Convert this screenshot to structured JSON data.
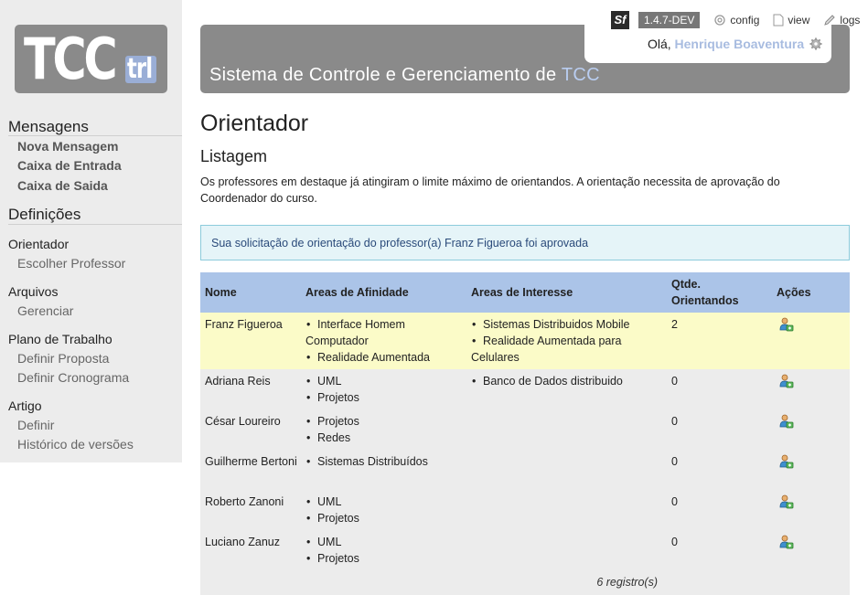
{
  "logo": {
    "main": "TCC",
    "suffix": "trl"
  },
  "sidebar": {
    "sections": [
      {
        "heading": "Mensagens",
        "links": [
          "Nova Mensagem",
          "Caixa de Entrada",
          "Caixa de Saida"
        ]
      },
      {
        "heading": "Definições"
      }
    ],
    "groups": [
      {
        "label": "Orientador",
        "links": [
          "Escolher Professor"
        ]
      },
      {
        "label": "Arquivos",
        "links": [
          "Gerenciar"
        ]
      },
      {
        "label": "Plano de Trabalho",
        "links": [
          "Definir Proposta",
          "Definir Cronograma"
        ]
      },
      {
        "label": "Artigo",
        "links": [
          "Definir",
          "Histórico de versões"
        ]
      }
    ]
  },
  "header": {
    "title_prefix": "Sistema de Controle e Gerenciamento de",
    "title_accent": "TCC",
    "greeting": "Olá,",
    "user_name": "Henrique Boaventura"
  },
  "debug_bar": {
    "logo": "Sf",
    "version": "1.4.7-DEV",
    "items": [
      "config",
      "view",
      "logs"
    ]
  },
  "page": {
    "title": "Orientador",
    "subtitle": "Listagem",
    "description": "Os professores em destaque já atingiram o limite máximo de orientandos. A orientação necessita de aprovação do Coordenador do curso.",
    "notice": "Sua solicitação de orientação do professor(a) Franz Figueroa foi aprovada"
  },
  "table": {
    "columns": [
      "Nome",
      "Areas de Afinidade",
      "Areas de Interesse",
      "Qtde. Orientandos",
      "Ações"
    ],
    "rows": [
      {
        "name": "Franz Figueroa",
        "affinity": [
          "Interface Homem Computador",
          "Realidade Aumentada"
        ],
        "interest": [
          "Sistemas Distribuidos Mobile",
          "Realidade Aumentada para Celulares"
        ],
        "count": "2",
        "highlight": true
      },
      {
        "name": "Adriana Reis",
        "affinity": [
          "UML",
          "Projetos"
        ],
        "interest": [
          "Banco de Dados distribuido"
        ],
        "count": "0",
        "highlight": false
      },
      {
        "name": "César Loureiro",
        "affinity": [
          "Projetos",
          "Redes"
        ],
        "interest": [],
        "count": "0",
        "highlight": false
      },
      {
        "name": "Guilherme Bertoni",
        "affinity": [
          "Sistemas Distribuídos"
        ],
        "interest": [],
        "count": "0",
        "highlight": false
      },
      {
        "name": "Roberto Zanoni",
        "affinity": [
          "UML",
          "Projetos"
        ],
        "interest": [],
        "count": "0",
        "highlight": false
      },
      {
        "name": "Luciano Zanuz",
        "affinity": [
          "UML",
          "Projetos"
        ],
        "interest": [],
        "count": "0",
        "highlight": false
      }
    ],
    "records": "6 registro(s)"
  },
  "icons": {
    "action": "add-user-icon",
    "gear": "gear-icon"
  },
  "colors": {
    "header_bg": "#8a8a8a",
    "accent": "#b9cdf0",
    "table_head": "#abc4e8",
    "highlight_row": "#fbfbc8",
    "notice_bg": "#e5f4f8",
    "notice_border": "#8ccbdb"
  }
}
